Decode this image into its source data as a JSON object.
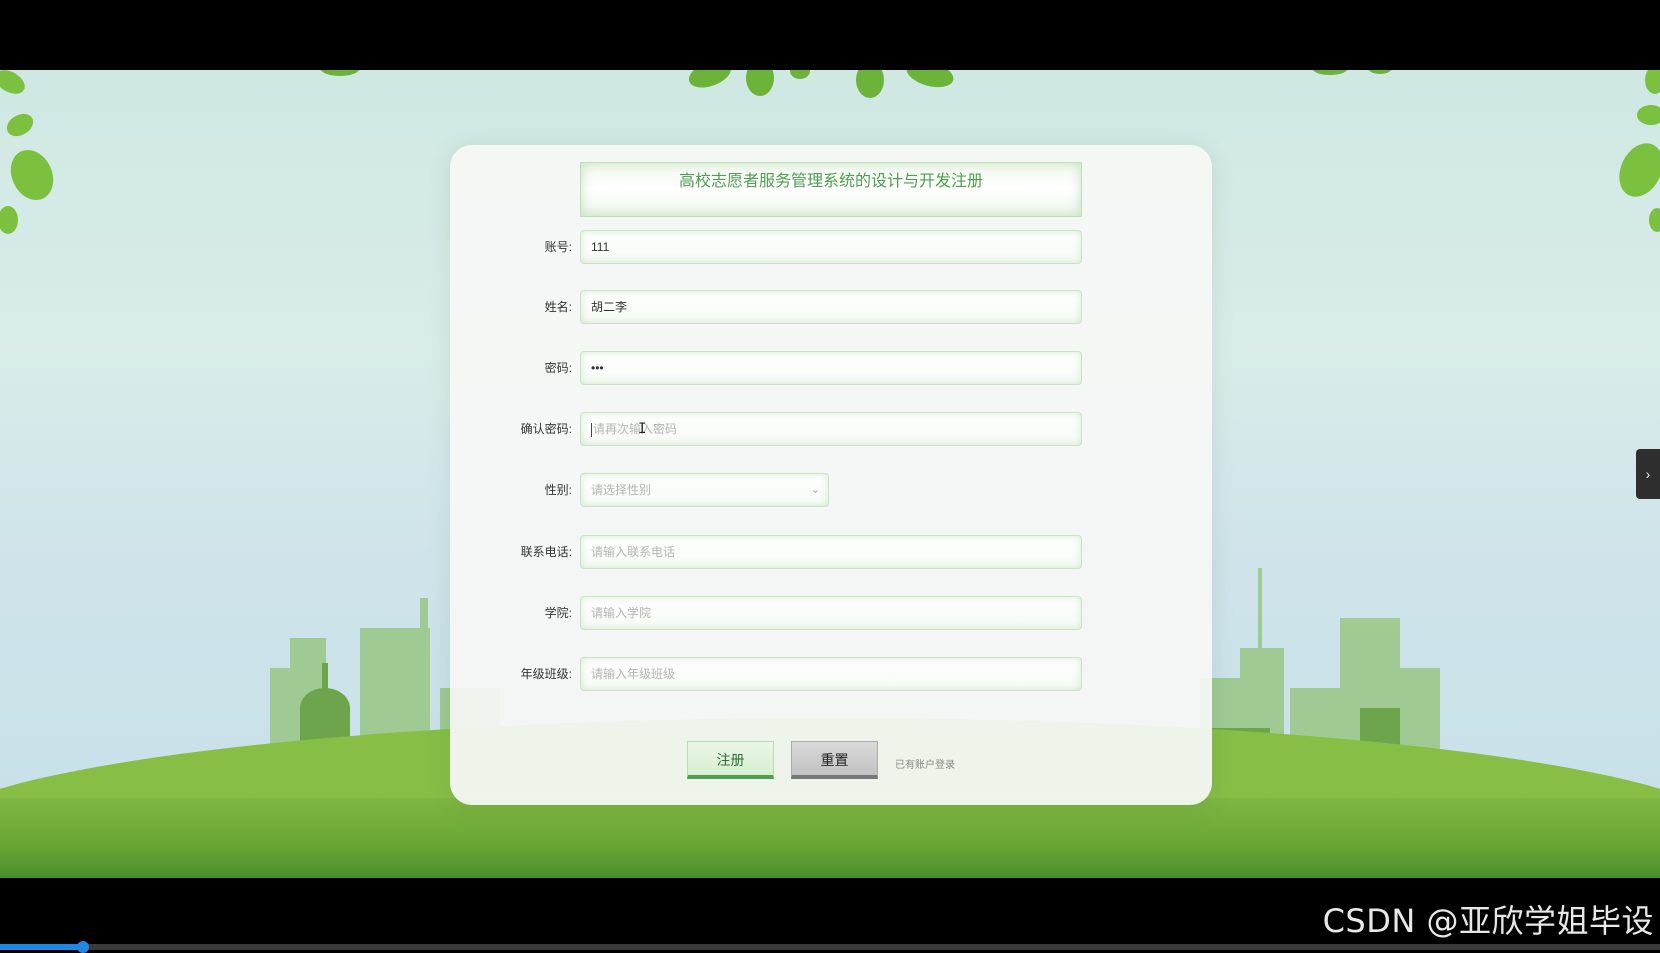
{
  "form": {
    "title": "高校志愿者服务管理系统的设计与开发注册",
    "fields": [
      {
        "label": "账号:",
        "value": "111",
        "placeholder": ""
      },
      {
        "label": "姓名:",
        "value": "胡二李",
        "placeholder": ""
      },
      {
        "label": "密码:",
        "value": "•••",
        "placeholder": ""
      },
      {
        "label": "确认密码:",
        "value": "",
        "placeholder": "请再次输入密码"
      },
      {
        "label": "性别:",
        "value": "",
        "placeholder": "请选择性别"
      },
      {
        "label": "联系电话:",
        "value": "",
        "placeholder": "请输入联系电话"
      },
      {
        "label": "学院:",
        "value": "",
        "placeholder": "请输入学院"
      },
      {
        "label": "年级班级:",
        "value": "",
        "placeholder": "请输入年级班级"
      }
    ],
    "gender_chevron": "⌄",
    "buttons": {
      "register": "注册",
      "reset": "重置",
      "login_link": "已有账户登录"
    }
  },
  "side_tab": {
    "icon": "chevron-right-icon",
    "glyph": "›"
  },
  "watermark": "CSDN @亚欣学姐毕设",
  "video_progress": 0.05,
  "colors": {
    "accent": "#4f9e52",
    "ground": "#7fb743",
    "sky": "#cfe8e2",
    "progress": "#1e88e5"
  }
}
